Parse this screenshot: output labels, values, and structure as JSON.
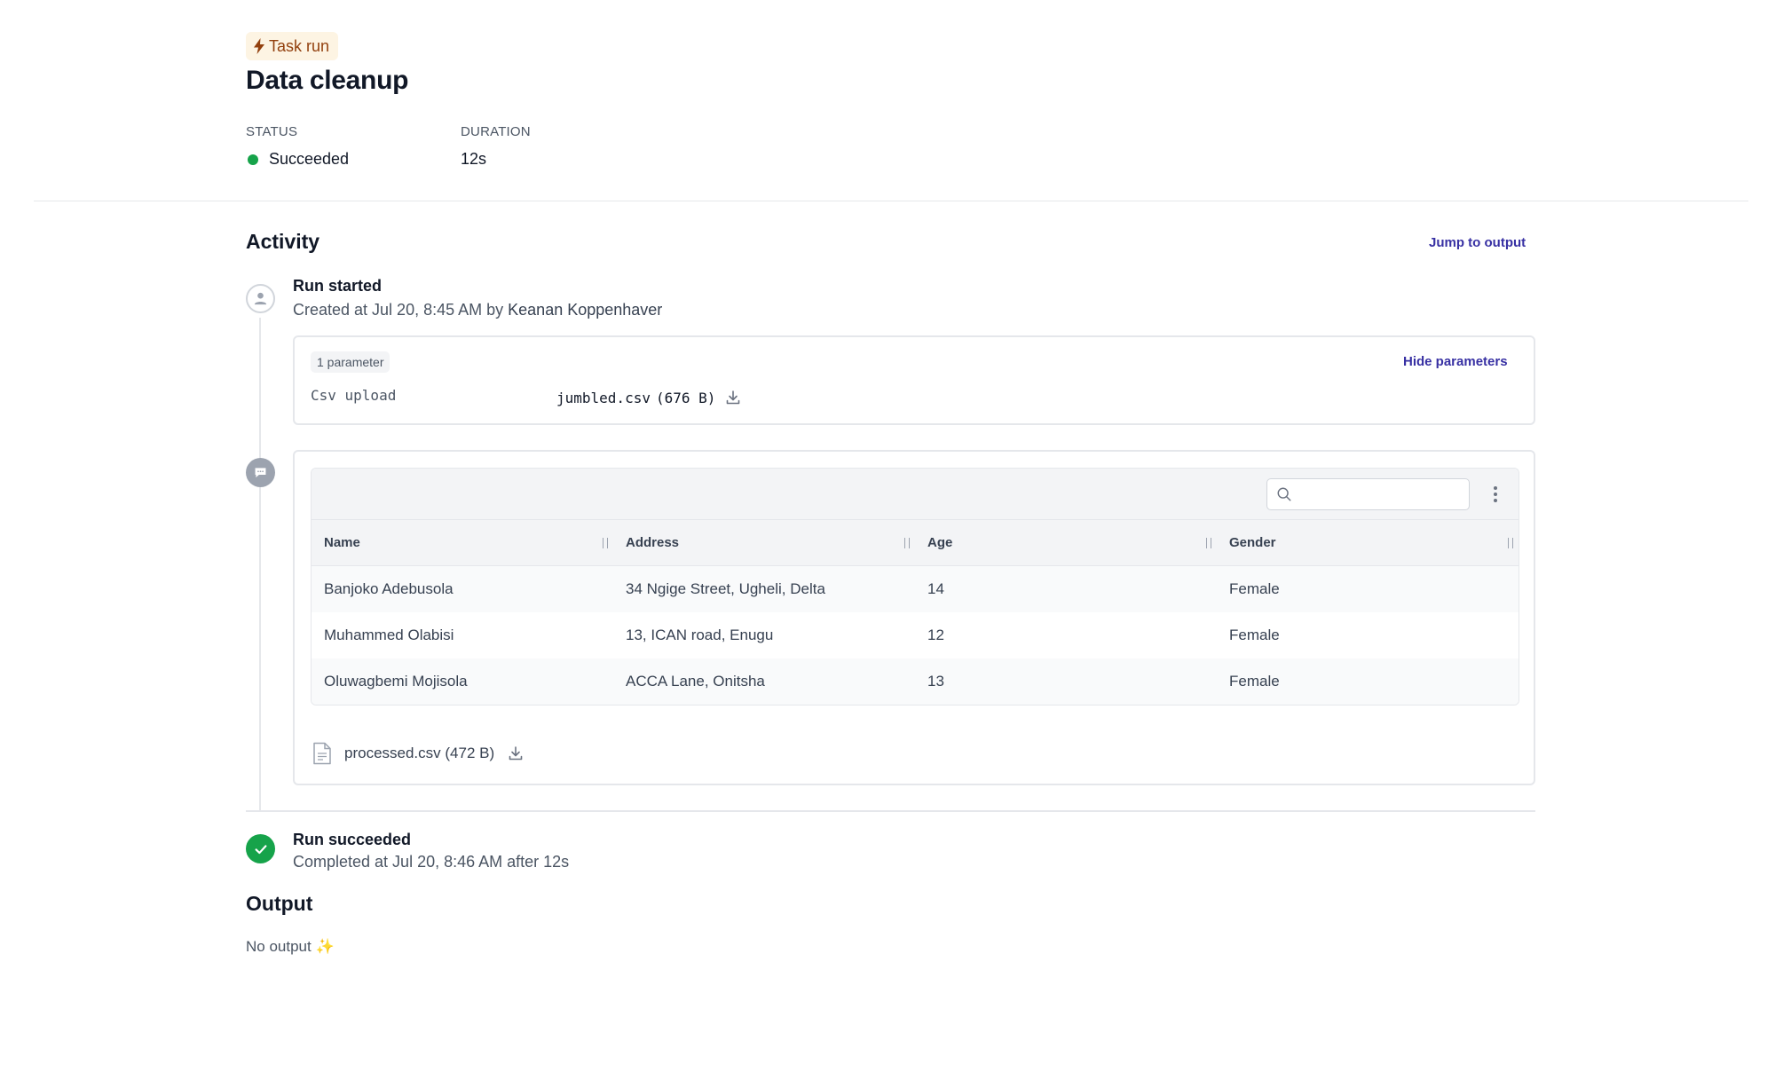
{
  "header": {
    "badge_label": "Task run",
    "title": "Data cleanup"
  },
  "meta": {
    "status_label": "STATUS",
    "status_value": "Succeeded",
    "duration_label": "DURATION",
    "duration_value": "12s"
  },
  "activity": {
    "title": "Activity",
    "jump_label": "Jump to output"
  },
  "run_started": {
    "title": "Run started",
    "created_prefix": "Created at Jul 20, 8:45 AM by",
    "user": "Keanan Koppenhaver"
  },
  "parameters": {
    "count_label": "1 parameter",
    "hide_label": "Hide parameters",
    "key": "Csv upload",
    "file_name": "jumbled.csv",
    "file_size": "(676 B)"
  },
  "table": {
    "columns": [
      "Name",
      "Address",
      "Age",
      "Gender"
    ],
    "rows": [
      [
        "Banjoko Adebusola",
        "34 Ngige Street, Ugheli, Delta",
        "14",
        "Female"
      ],
      [
        "Muhammed Olabisi",
        "13, ICAN road, Enugu",
        "12",
        "Female"
      ],
      [
        "Oluwagbemi Mojisola",
        "ACCA Lane, Onitsha",
        "13",
        "Female"
      ]
    ],
    "search_placeholder": ""
  },
  "processed_file": {
    "label": "processed.csv (472 B)"
  },
  "run_succeeded": {
    "title": "Run succeeded",
    "subtitle": "Completed at Jul 20, 8:46 AM after 12s"
  },
  "output": {
    "title": "Output",
    "empty_text": "No output",
    "empty_emoji": "✨"
  },
  "colors": {
    "accent": "#3730a3",
    "success": "#16a34a",
    "badge_bg": "#fdf4e3",
    "badge_text": "#92400e"
  }
}
